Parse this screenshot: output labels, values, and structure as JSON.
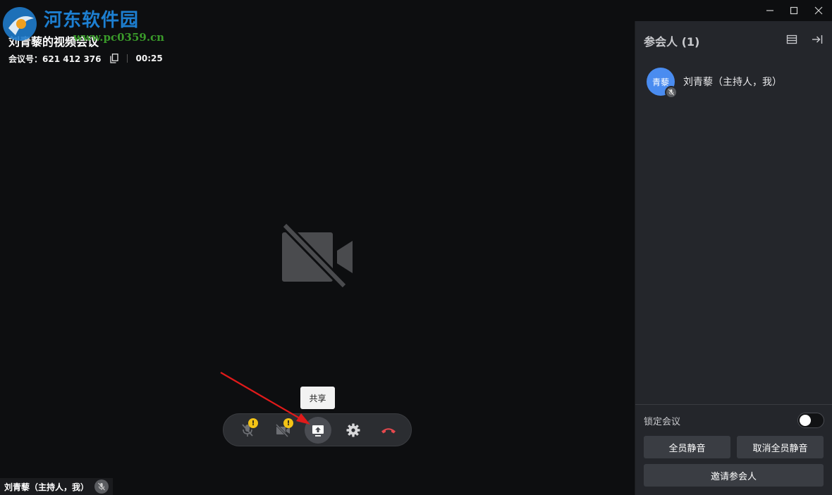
{
  "watermark": {
    "title": "河东软件园",
    "url": "www.pc0359.cn"
  },
  "meeting": {
    "title": "刘青藜的视频会议",
    "id_label": "会议号：621 412 376",
    "timer": "00:25"
  },
  "tooltip": {
    "share": "共享"
  },
  "self_label": {
    "name": "刘青藜（主持人，我）"
  },
  "panel": {
    "title": "参会人 (1)",
    "participants": [
      {
        "avatar_text": "青藜",
        "name": "刘青藜（主持人，我）"
      }
    ],
    "lock_label": "锁定会议",
    "lock_on": false,
    "mute_all": "全员静音",
    "unmute_all": "取消全员静音",
    "invite": "邀请参会人"
  },
  "colors": {
    "accent": "#4a8cf0",
    "warning": "#f3c316",
    "hangup": "#e5484d",
    "arrow": "#e01a1a"
  },
  "icons": {
    "toolbar": [
      "mic-muted-icon",
      "camera-off-icon",
      "share-screen-icon",
      "gear-icon",
      "hang-up-icon"
    ]
  }
}
